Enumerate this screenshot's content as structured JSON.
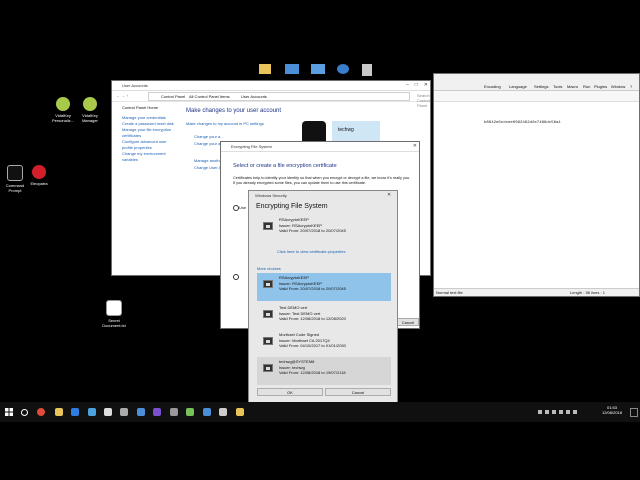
{
  "desktop_icons": [
    {
      "label": "VidalKey Personaliz...",
      "name": "vidalkey-personalize-icon"
    },
    {
      "label": "VidalKey Manager",
      "name": "vidalkey-manager-icon"
    },
    {
      "label": "Command Prompt",
      "name": "command-prompt-icon"
    },
    {
      "label": "Eleopatra",
      "name": "eleopatra-icon"
    },
    {
      "label": "Secret Document.txt",
      "name": "secret-document-icon"
    }
  ],
  "user_accounts": {
    "title": "User Accounts",
    "breadcrumb": [
      "Control Panel",
      "All Control Panel Items",
      "User Accounts"
    ],
    "search_placeholder": "Search Control Panel",
    "sidebar": [
      "Control Panel Home",
      "Manage your credentials",
      "Create a password reset disk",
      "Manage your file encryption certificates",
      "Configure advanced user profile properties",
      "Change my environment variables"
    ],
    "heading": "Make changes to your user account",
    "sub_link": "Make changes to my account in PC settings",
    "change_links": [
      "Change your a...",
      "Change your a...",
      "Manage anothe...",
      "Change User A..."
    ],
    "username": "techwg"
  },
  "notepad": {
    "menu": [
      "Encoding",
      "Language",
      "Settings",
      "Tools",
      "Macro",
      "Run",
      "Plugins",
      "Window",
      "?"
    ],
    "hex_text": "b8642e0cdcee0092482d2e7468dc56a1",
    "status_left": "Normal text file",
    "status_right": "Length : 56   lines : 1"
  },
  "efs": {
    "title": "Encrypting File System",
    "heading": "Select or create a file encryption certificate",
    "description": "Certificates help to identify your identity so that when you encrypt or decrypt a file, we know it's really you. If you already encrypted some files, you can update them to use this certificate.",
    "use_label": "Use",
    "cancel_label": "Cancel"
  },
  "security": {
    "window_title": "Windows Security",
    "heading": "Encrypting File System",
    "selected": {
      "name": "RSAcryptoKEEP",
      "issuer": "Issuer: RSAcryptoKEEP",
      "valid": "Valid From: 20/07/2018 to 20/07/2045"
    },
    "view_link": "Click here to view certificate properties",
    "more_choices": "More choices",
    "certs": [
      {
        "name": "RSAcryptoKEEP",
        "issuer": "Issuer: RSAcryptoKEEP",
        "valid": "Valid From: 20/07/2018 to 20/07/2045"
      },
      {
        "name": "Test DEMO cert",
        "issuer": "Issuer: Test DEMO cert",
        "valid": "Valid From: 12/08/2018 to 12/08/2020"
      },
      {
        "name": "Morthaet Code Signed",
        "issuer": "Issuer: Morthaet CA 2017Q4",
        "valid": "Valid From: 04/10/2017 to 01/01/2030"
      },
      {
        "name": "techwg@SYSTEM8",
        "issuer": "Issuer: techwg",
        "valid": "Valid From: 12/08/2018 to 19/07/2118"
      }
    ],
    "ok_label": "OK",
    "cancel_label": "Cancel"
  },
  "taskbar": {
    "time": "01:53",
    "date": "12/08/2018"
  },
  "colors": {
    "selection": "#8fc3ea",
    "accent": "#1a5fb4"
  }
}
